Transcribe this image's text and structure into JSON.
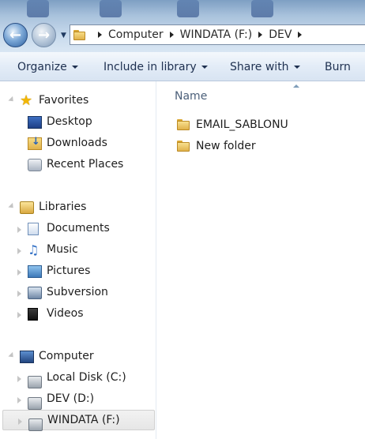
{
  "address": {
    "crumbs": [
      "Computer",
      "WINDATA (F:)",
      "DEV"
    ]
  },
  "toolbar": {
    "organize": "Organize",
    "include": "Include in library",
    "share": "Share with",
    "burn": "Burn"
  },
  "nav": {
    "favorites": {
      "label": "Favorites",
      "items": [
        "Desktop",
        "Downloads",
        "Recent Places"
      ]
    },
    "libraries": {
      "label": "Libraries",
      "items": [
        "Documents",
        "Music",
        "Pictures",
        "Subversion",
        "Videos"
      ]
    },
    "computer": {
      "label": "Computer",
      "items": [
        "Local Disk (C:)",
        "DEV (D:)",
        "WINDATA (F:)"
      ],
      "selected": "WINDATA (F:)"
    }
  },
  "content": {
    "column_header": "Name",
    "files": [
      "EMAIL_SABLONU",
      "New folder"
    ]
  },
  "colors": {
    "accent": "#2d5f9f",
    "folder": "#e0b24b"
  }
}
